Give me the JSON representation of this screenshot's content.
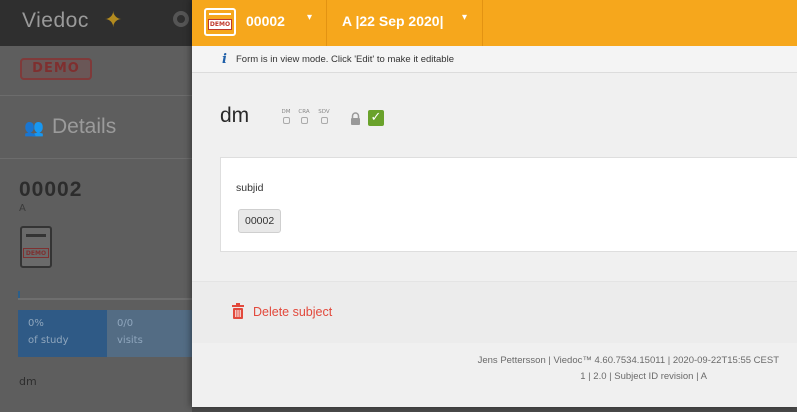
{
  "background": {
    "logo": "Viedoc",
    "demo_badge": "DEMO",
    "section_title": "Details",
    "subject_id": "00002",
    "subject_site": "A",
    "card_label": "DEMO",
    "stats": [
      {
        "value": "0%",
        "label": "of study"
      },
      {
        "value": "0/0",
        "label": "visits"
      }
    ],
    "form_item": "dm"
  },
  "header": {
    "card_label": "DEMO",
    "subject": "00002",
    "visit": "A |22 Sep 2020|",
    "accent_color": "#f6a71c"
  },
  "info": {
    "icon": "info-icon",
    "message": "Form is in view mode. Click 'Edit' to make it editable"
  },
  "form": {
    "title": "dm",
    "flags": [
      {
        "label": "DM"
      },
      {
        "label": "CRA"
      },
      {
        "label": "SDV"
      }
    ],
    "field_label": "subjid",
    "field_value": "00002"
  },
  "actions": {
    "delete_label": "Delete subject",
    "delete_color": "#e2493c"
  },
  "footer": {
    "line1": "Jens Pettersson | Viedoc™ 4.60.7534.15011 | 2020-09-22T15:55 CEST",
    "line2": "1 | 2.0 | Subject ID revision | A"
  }
}
